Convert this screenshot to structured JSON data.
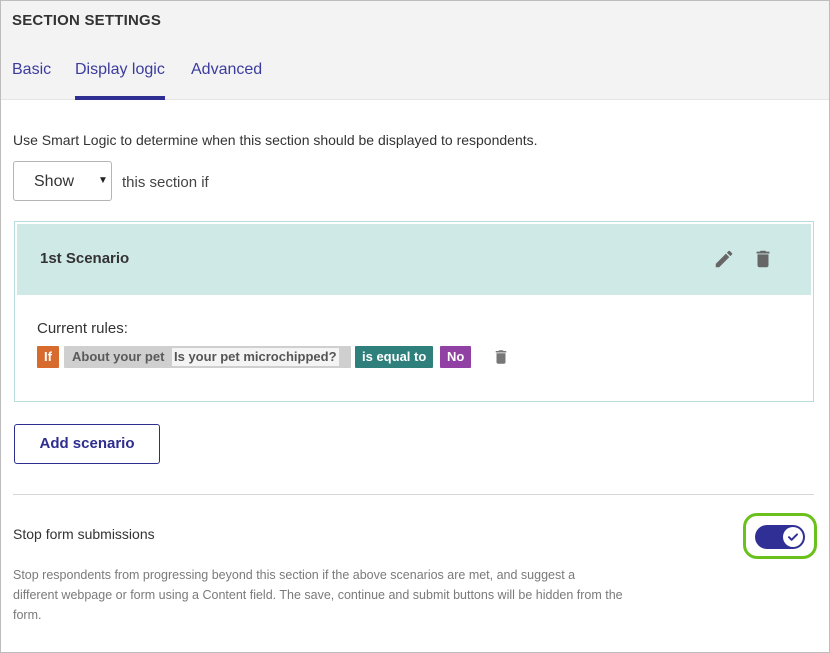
{
  "header": {
    "title": "SECTION SETTINGS",
    "tabs": [
      {
        "label": "Basic",
        "active": false
      },
      {
        "label": "Display logic",
        "active": true
      },
      {
        "label": "Advanced",
        "active": false
      }
    ]
  },
  "logic": {
    "intro": "Use Smart Logic to determine when this section should be displayed to respondents.",
    "select_value": "Show",
    "select_suffix": "this section if"
  },
  "scenario": {
    "title": "1st Scenario",
    "rules_label": "Current rules:",
    "rule": {
      "if_label": "If",
      "section": "About your pet",
      "question": "Is your pet microchipped?",
      "operator": "is equal to",
      "value": "No"
    },
    "icons": {
      "edit": "pencil-icon",
      "delete": "trash-icon"
    }
  },
  "add_scenario_label": "Add scenario",
  "stop": {
    "label": "Stop form submissions",
    "description": "Stop respondents from progressing beyond this section if the above scenarios are met, and suggest a different webpage or form using a Content field. The save, continue and submit buttons will be hidden from the form.",
    "enabled": true
  },
  "colors": {
    "accent": "#2e2e92",
    "scenario_bg": "#cfe9e6",
    "if_chip": "#d76a2d",
    "operator_chip": "#2f7f7c",
    "value_chip": "#9140a4",
    "highlight_ring": "#6ac11d"
  }
}
